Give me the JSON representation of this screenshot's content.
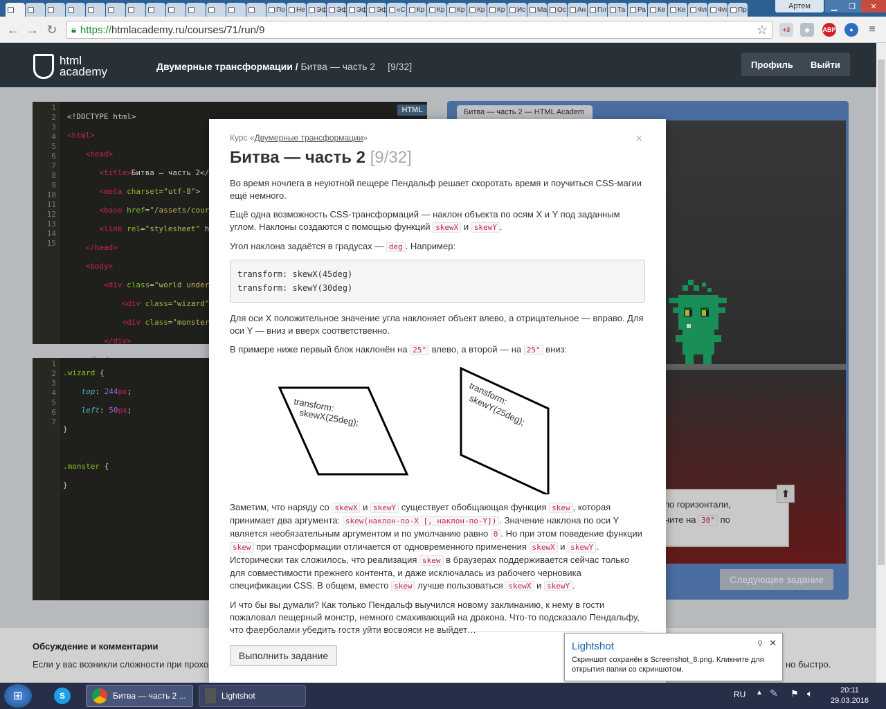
{
  "browser": {
    "tabs": [
      "",
      "",
      "",
      "",
      "",
      "",
      "",
      "",
      "",
      "",
      "",
      "",
      "",
      "По",
      "Не",
      "Эф",
      "Эф",
      "Эф",
      "Эф",
      "«С",
      "Кр",
      "Кр",
      "Кр",
      "Кр",
      "Кр",
      "Ис",
      "Ма",
      "Ос",
      "Ан",
      "Пл",
      "Та",
      "Ра",
      "Ке",
      "Ке",
      "Фл",
      "Фл",
      "Пр"
    ],
    "user": "Артем",
    "url_scheme": "https://",
    "url_rest": "htmlacademy.ru/courses/71/run/9",
    "ext_badge": "+3",
    "abp": "ABP"
  },
  "site": {
    "logo_line1": "html",
    "logo_line2": "academy",
    "breadcrumb_course": "Двумерные трансформации / ",
    "breadcrumb_task": "Битва — часть 2",
    "breadcrumb_counter": "[9/32]",
    "profile_label": "Профиль",
    "logout_label": "Выйти"
  },
  "html_editor": {
    "badge": "HTML",
    "line_numbers": [
      "1",
      "2",
      "3",
      "4",
      "5",
      "6",
      "7",
      "8",
      "9",
      "10",
      "11",
      "12",
      "13",
      "14",
      "15"
    ]
  },
  "css_editor": {
    "line_numbers": [
      "1",
      "2",
      "3",
      "4",
      "5",
      "6",
      "7"
    ]
  },
  "preview": {
    "tab_title": "Битва — часть 2 — HTML Academ",
    "task_line1": "по горизонтали,",
    "task_line2a": "ните на ",
    "task_code": "30°",
    "task_line2b": " по",
    "next_label": "Следующее задание"
  },
  "discussion": {
    "title": "Обсуждение и комментарии",
    "text_left": "Если у вас возникли сложности при прохо",
    "text_right": "но быстро."
  },
  "modal": {
    "course_prefix": "Курс «",
    "course_link": "Двумерные трансформации",
    "course_suffix": "»",
    "title": "Битва — часть 2 ",
    "counter": "[9/32]",
    "close": "×",
    "p1": "Во время ночлега в неуютной пещере Пендальф решает скоротать время и поучиться CSS-магии ещё немного.",
    "p2_text": "Ещё одна возможность CSS-трансформаций — наклон объекта по осям X и Y под заданным углом. Наклоны создаются с помощью функций ",
    "p2_and": " и ",
    "p2_end": ".",
    "skewX": "skewX",
    "skewY": "skewY",
    "skew": "skew",
    "p3_text": "Угол наклона задаётся в градусах — ",
    "deg": "deg",
    "p3_end": ". Например:",
    "code_line1": "transform: skewX(45deg)",
    "code_line2": "transform: skewY(30deg)",
    "p4": "Для оси X положительное значение угла наклоняет объект влево, а отрицательное — вправо. Для оси Y — вниз и вверх соответственно.",
    "p5_a": "В примере ниже первый блок наклонён на ",
    "p5_b": " влево, а второй — на ",
    "p5_c": " вниз:",
    "deg25": "25°",
    "box1_line1": "transform:",
    "box1_line2": "skewX(25deg);",
    "box2_line1": "transform:",
    "box2_line2": "skewY(25deg);",
    "p6_a": "Заметим, что наряду со ",
    "p6_b": " и ",
    "p6_c": " существует обобщающая функция ",
    "p6_d": ", которая принимает два аргумента: ",
    "skew_sig": "skew(наклон-по-X [, наклон-по-Y])",
    "p6_e": ". Значение наклона по оси Y является необязательным аргументом и по умолчанию равно ",
    "zero": "0",
    "p6_f": ". Но при этом поведение функции ",
    "p6_g": " при трансформации отличается от одновременного применения ",
    "p6_h": " и ",
    "p6_i": ". Исторически так сложилось, что реализация ",
    "p6_j": " в браузерах поддерживается сейчас только для совместимости прежнего контента, и даже исключалась из рабочего черновика спецификации CSS. В общем, вместо ",
    "p6_k": " лучше пользоваться ",
    "p6_l": " и ",
    "p6_m": ".",
    "p7": "И что бы вы думали? Как только Пендальф выучился новому заклинанию, к нему в гости пожаловал пещерный монстр, немного смахивающий на дракона. Что-то подсказало Пендальфу, что фаерболами убедить гостя уйти восвояси не выйдет…",
    "run_label": "Выполнить задание"
  },
  "lightshot": {
    "title": "Lightshot",
    "message": "Скриншот сохранён в Screenshot_8.png. Кликните для открытия папки со скриншотом."
  },
  "taskbar": {
    "chrome_label": "Битва — часть 2 ...",
    "lightshot_label": "Lightshot",
    "lang": "RU",
    "time": "20:11",
    "date": "29.03.2016"
  },
  "colors": {
    "header_bg": "#283038",
    "editor_bg": "#272822",
    "preview_frame": "#5b87c2",
    "monster_green": "#1fae6a"
  }
}
